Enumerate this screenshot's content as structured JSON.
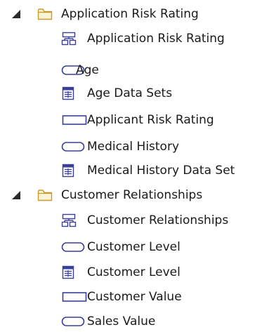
{
  "tree": [
    {
      "label": "Application Risk Rating",
      "kind": "package",
      "expanded": true,
      "icon": "folder-icon",
      "children": [
        {
          "label": "Application Risk Rating",
          "icon": "decision-diagram-icon"
        },
        {
          "label": "Age",
          "icon": "input-data-icon"
        },
        {
          "label": "Age Data Sets",
          "icon": "data-set-icon"
        },
        {
          "label": "Applicant Risk Rating",
          "icon": "decision-icon"
        },
        {
          "label": "Medical History",
          "icon": "input-data-icon"
        },
        {
          "label": "Medical History Data Set",
          "icon": "data-set-icon"
        }
      ]
    },
    {
      "label": "Customer Relationships",
      "kind": "package",
      "expanded": true,
      "icon": "folder-icon",
      "children": [
        {
          "label": "Customer Relationships",
          "icon": "decision-diagram-icon"
        },
        {
          "label": "Customer Level",
          "icon": "input-data-icon"
        },
        {
          "label": "Customer Level",
          "icon": "data-set-icon"
        },
        {
          "label": "Customer Value",
          "icon": "decision-icon"
        },
        {
          "label": "Sales Value",
          "icon": "input-data-icon"
        }
      ]
    }
  ],
  "colors": {
    "icon_blue": "#3a3f9a",
    "folder_outline": "#c89b2c",
    "folder_fill": "#fbf3d5",
    "expander": "#2b2b2b",
    "text": "#1a1a1a"
  }
}
